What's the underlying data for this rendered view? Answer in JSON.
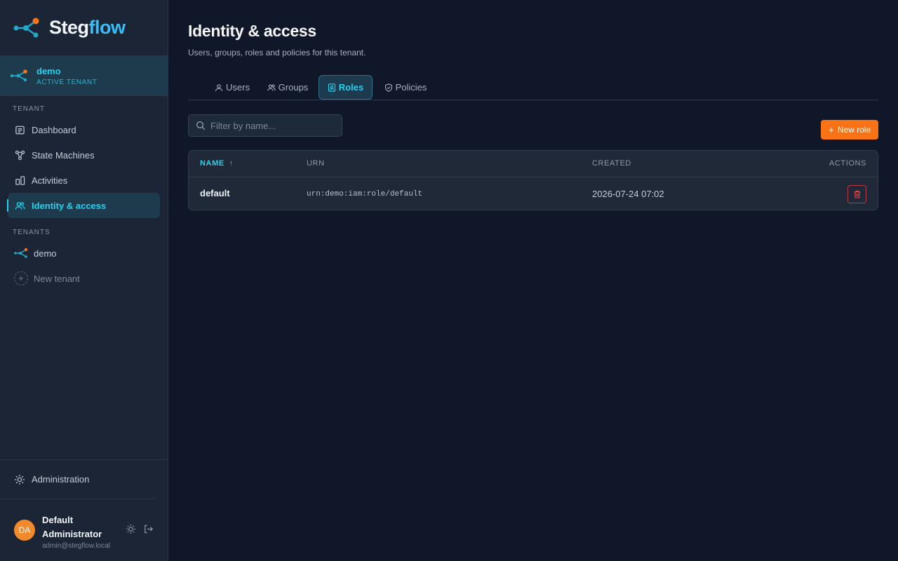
{
  "brand": {
    "name_part1": "Steg",
    "name_part2": "flow",
    "icon": "flow-nodes-icon"
  },
  "active_tenant": {
    "name": "demo",
    "label": "ACTIVE TENANT"
  },
  "sidebar": {
    "tenant_section_label": "TENANT",
    "items": [
      {
        "label": "Dashboard",
        "icon": "dashboard-icon"
      },
      {
        "label": "State Machines",
        "icon": "state-machine-icon"
      },
      {
        "label": "Activities",
        "icon": "activities-icon"
      },
      {
        "label": "Identity & access",
        "icon": "users-icon",
        "active": true
      }
    ],
    "tenants_section_label": "TENANTS",
    "tenants": [
      {
        "label": "demo"
      }
    ],
    "new_tenant_label": "New tenant",
    "admin_label": "Administration"
  },
  "user": {
    "initials": "DA",
    "name": "Default Administrator",
    "email": "admin@stegflow.local",
    "avatar_color": "#f28a2b"
  },
  "page": {
    "title": "Identity & access",
    "subtitle": "Users, groups, roles and policies for this tenant."
  },
  "tabs": [
    {
      "label": "Users",
      "icon": "user-icon"
    },
    {
      "label": "Groups",
      "icon": "group-icon"
    },
    {
      "label": "Roles",
      "icon": "role-badge-icon",
      "active": true
    },
    {
      "label": "Policies",
      "icon": "shield-icon"
    }
  ],
  "search": {
    "placeholder": "Filter by name...",
    "value": ""
  },
  "new_role_label": "New role",
  "table": {
    "columns": {
      "name": "NAME",
      "urn": "URN",
      "created": "CREATED",
      "actions": "ACTIONS"
    },
    "sort_column": "name",
    "sort_direction": "ascending",
    "rows": [
      {
        "name": "default",
        "urn": "urn:demo:iam:role/default",
        "created": "2026-07-24 07:02"
      }
    ]
  },
  "colors": {
    "accent": "#22d3ee",
    "brand_orange": "#f97316",
    "danger": "#ef4444",
    "background": "#0f1729",
    "sidebar": "#1b2535"
  }
}
